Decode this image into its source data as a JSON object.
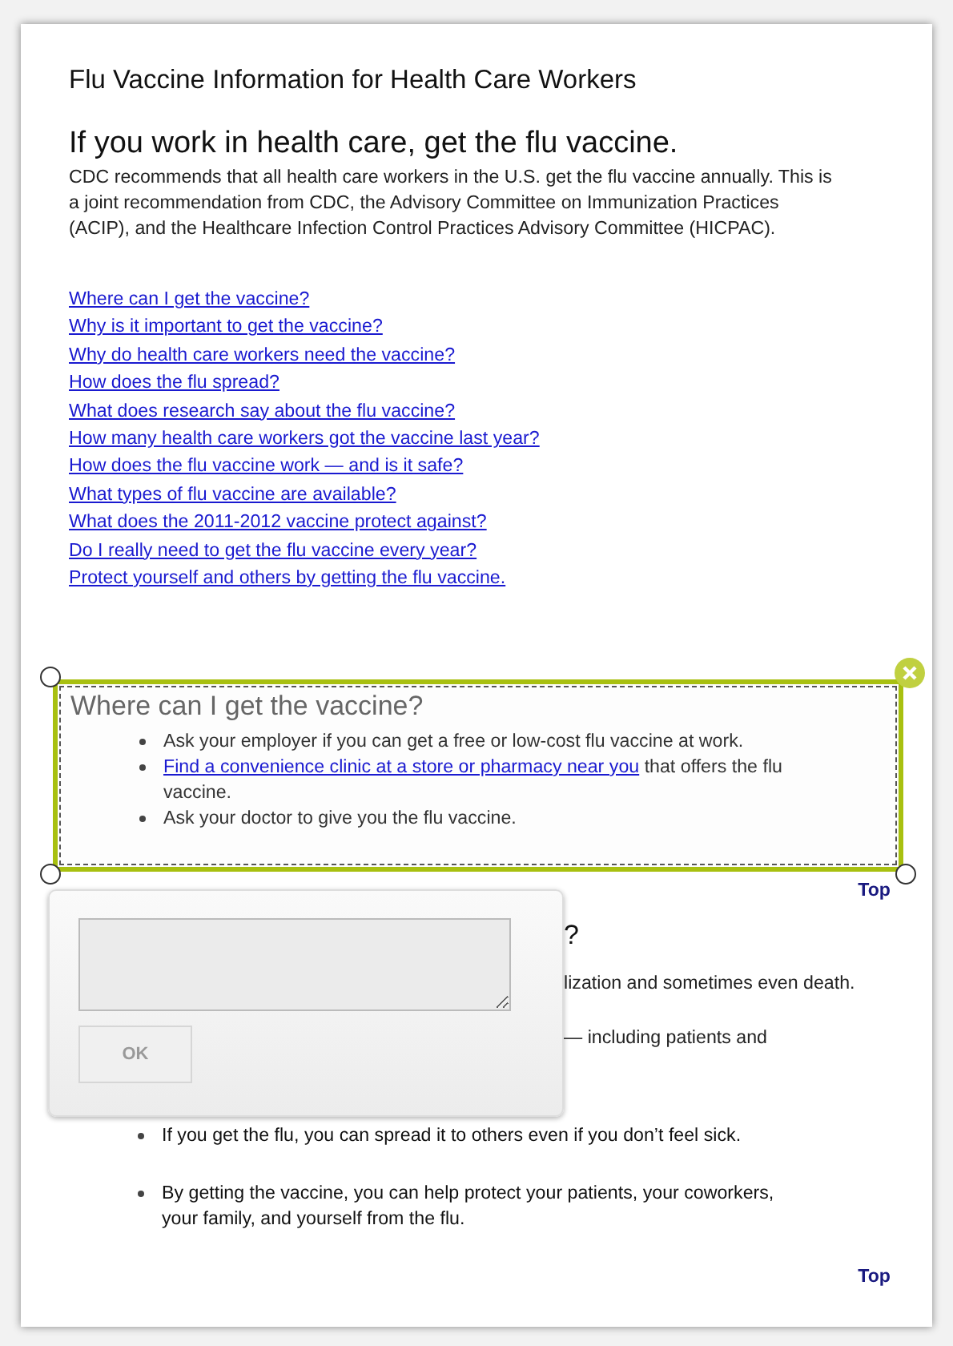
{
  "page": {
    "title": "Flu Vaccine Information for Health Care Workers",
    "heading": "If you work in health care, get the flu vaccine.",
    "intro": "CDC recommends that all health care workers in the U.S. get the flu vaccine annually. This is a joint recommendation from CDC, the Advisory Committee on Immunization Practices (ACIP), and the Healthcare Infection Control Practices Advisory Committee (HICPAC).",
    "toc_links": [
      "Where can I get the vaccine?",
      "Why is it important to get the vaccine?",
      "Why do health care workers need the vaccine?",
      "How does the flu spread?",
      "What does research say about the flu vaccine?",
      "How many health care workers got the vaccine last year?",
      "How does the flu vaccine work — and is it safe?",
      "What types of flu vaccine are available?",
      "What does the 2011-2012 vaccine protect against?",
      "Do I really need to get the flu vaccine every year?",
      "Protect yourself and others by getting the flu vaccine."
    ]
  },
  "sections": [
    {
      "heading": "Where can I get the vaccine?",
      "selected": true,
      "bullets": [
        {
          "text": "Ask your employer if you can get a free or low-cost flu vaccine at work."
        },
        {
          "link": "Find a convenience clinic at a store or pharmacy near you",
          "text": " that offers the flu vaccine."
        },
        {
          "text": "Ask your doctor to give you the flu vaccine."
        }
      ],
      "top_link": "Top"
    },
    {
      "heading": "?",
      "selected": false,
      "lines": [
        "lization and sometimes even death.",
        "— including patients and"
      ],
      "bullets": [
        {
          "text": "If you get the flu, you can spread it to others even if you don’t feel sick."
        },
        {
          "text": "By getting the vaccine, you can help protect your patients, your coworkers, your family, and yourself from the flu."
        }
      ],
      "top_link": "Top"
    }
  ],
  "popup": {
    "button": "OK",
    "disabled": true
  }
}
